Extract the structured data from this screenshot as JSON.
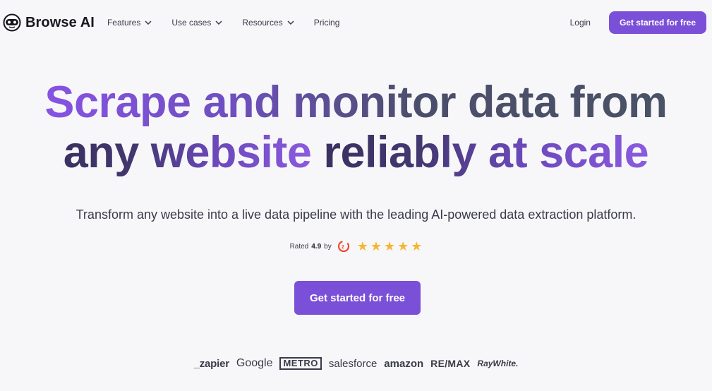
{
  "nav": {
    "logo_text": "Browse AI",
    "menu": [
      {
        "label": "Features",
        "has_dropdown": true
      },
      {
        "label": "Use cases",
        "has_dropdown": true
      },
      {
        "label": "Resources",
        "has_dropdown": true
      },
      {
        "label": "Pricing",
        "has_dropdown": false
      }
    ],
    "login_label": "Login",
    "cta_label": "Get started for free"
  },
  "hero": {
    "line1_part1": "Scrape and monitor data from",
    "line2_part1": "any website",
    "line2_part2": "reliably at scale",
    "subtitle": "Transform any website into a live data pipeline with the leading AI-powered data extraction platform.",
    "rating_prefix": "Rated",
    "rating_value": "4.9",
    "rating_suffix": "by",
    "rating_stars": 5,
    "rating_source_icon": "g2-logo-icon",
    "cta_label": "Get started for free"
  },
  "logos": [
    "_zapier",
    "Google",
    "METRO",
    "salesforce",
    "amazon",
    "RE/MAX",
    "RayWhite."
  ],
  "colors": {
    "brand_purple": "#7b50d8",
    "star": "#f5b730",
    "background": "#f7f7f9"
  }
}
